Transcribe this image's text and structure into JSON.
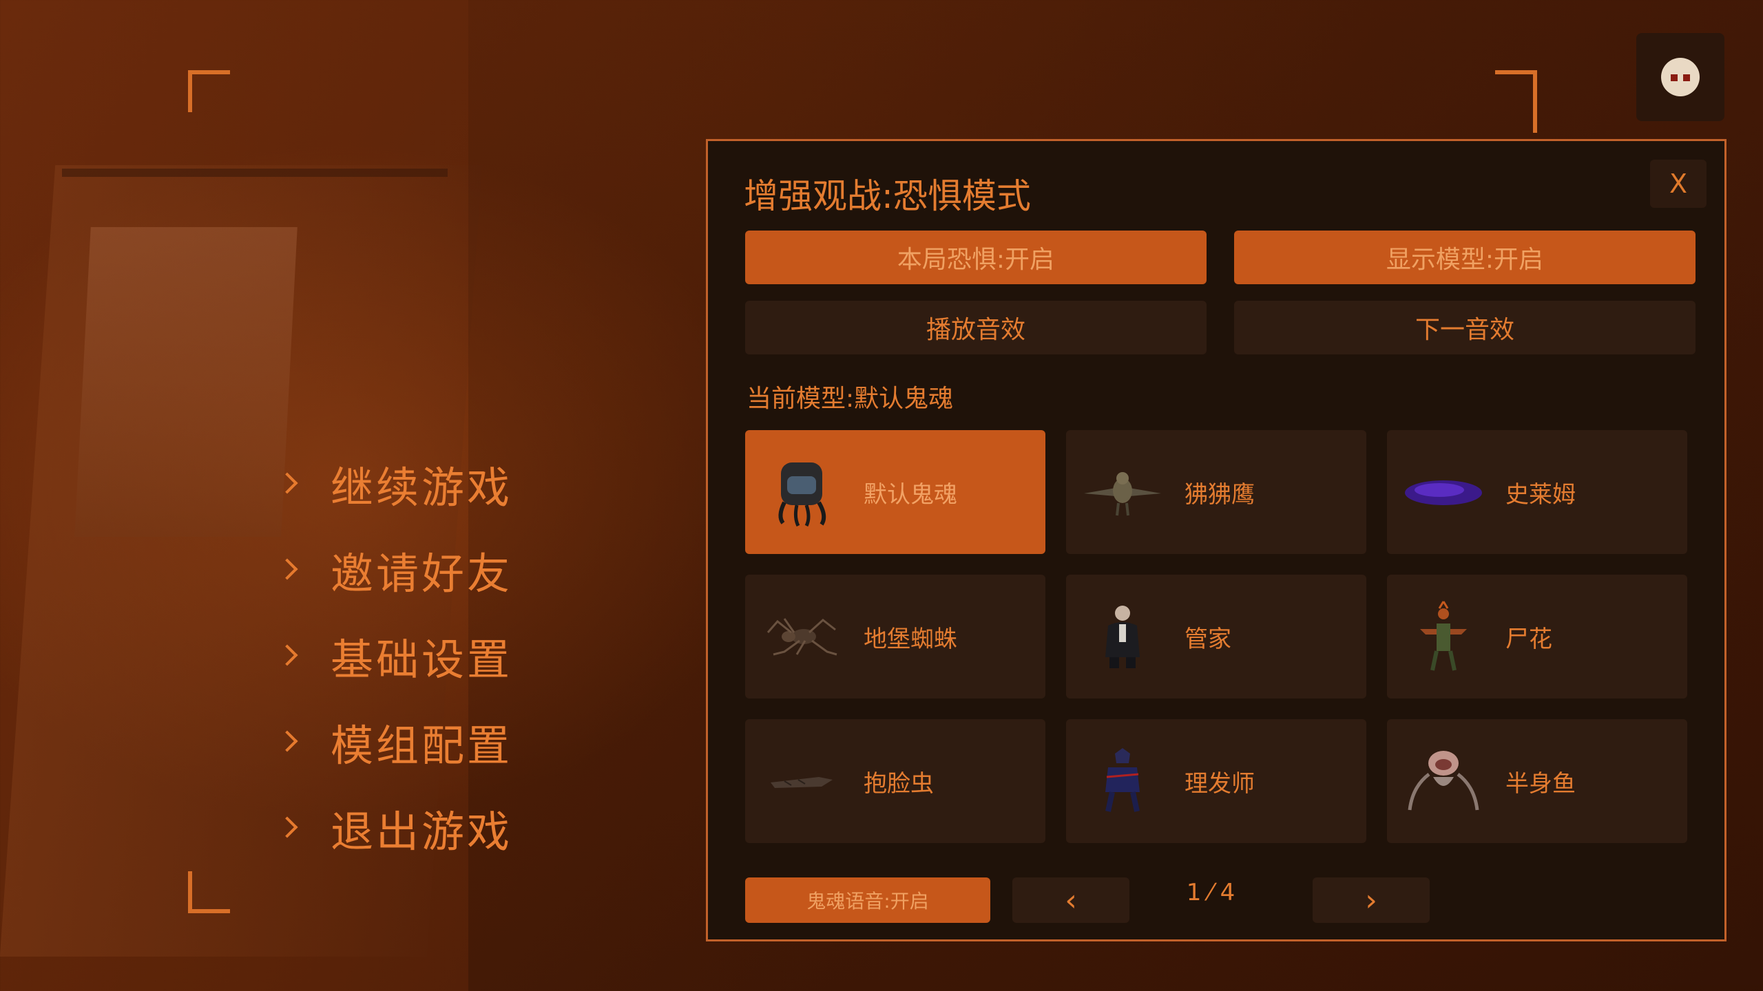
{
  "menu": {
    "items": [
      {
        "label": "继续游戏"
      },
      {
        "label": "邀请好友"
      },
      {
        "label": "基础设置"
      },
      {
        "label": "模组配置"
      },
      {
        "label": "退出游戏"
      }
    ]
  },
  "panel": {
    "title": "增强观战:恐惧模式",
    "close_label": "X",
    "toggles": {
      "round_fear": "本局恐惧:开启",
      "show_model": "显示模型:开启"
    },
    "sound": {
      "play": "播放音效",
      "next": "下一音效"
    },
    "current_model": "当前模型:默认鬼魂",
    "models": [
      {
        "name": "默认鬼魂",
        "selected": true,
        "icon": "ghost-icon"
      },
      {
        "name": "狒狒鹰",
        "selected": false,
        "icon": "baboon-hawk-icon"
      },
      {
        "name": "史莱姆",
        "selected": false,
        "icon": "slime-icon"
      },
      {
        "name": "地堡蜘蛛",
        "selected": false,
        "icon": "bunker-spider-icon"
      },
      {
        "name": "管家",
        "selected": false,
        "icon": "butler-icon"
      },
      {
        "name": "尸花",
        "selected": false,
        "icon": "corpse-flower-icon"
      },
      {
        "name": "抱脸虫",
        "selected": false,
        "icon": "facehugger-icon"
      },
      {
        "name": "理发师",
        "selected": false,
        "icon": "barber-icon"
      },
      {
        "name": "半身鱼",
        "selected": false,
        "icon": "half-fish-icon"
      }
    ],
    "footer": {
      "ghost_voice": "鬼魂语音:开启",
      "prev_label": "‹",
      "next_label": "›",
      "page": "1 ⁄ 4"
    }
  },
  "colors": {
    "accent": "#e47c30",
    "button_on": "#c6571a",
    "button_off": "#2f1c11",
    "panel_bg": "#1f1209"
  }
}
